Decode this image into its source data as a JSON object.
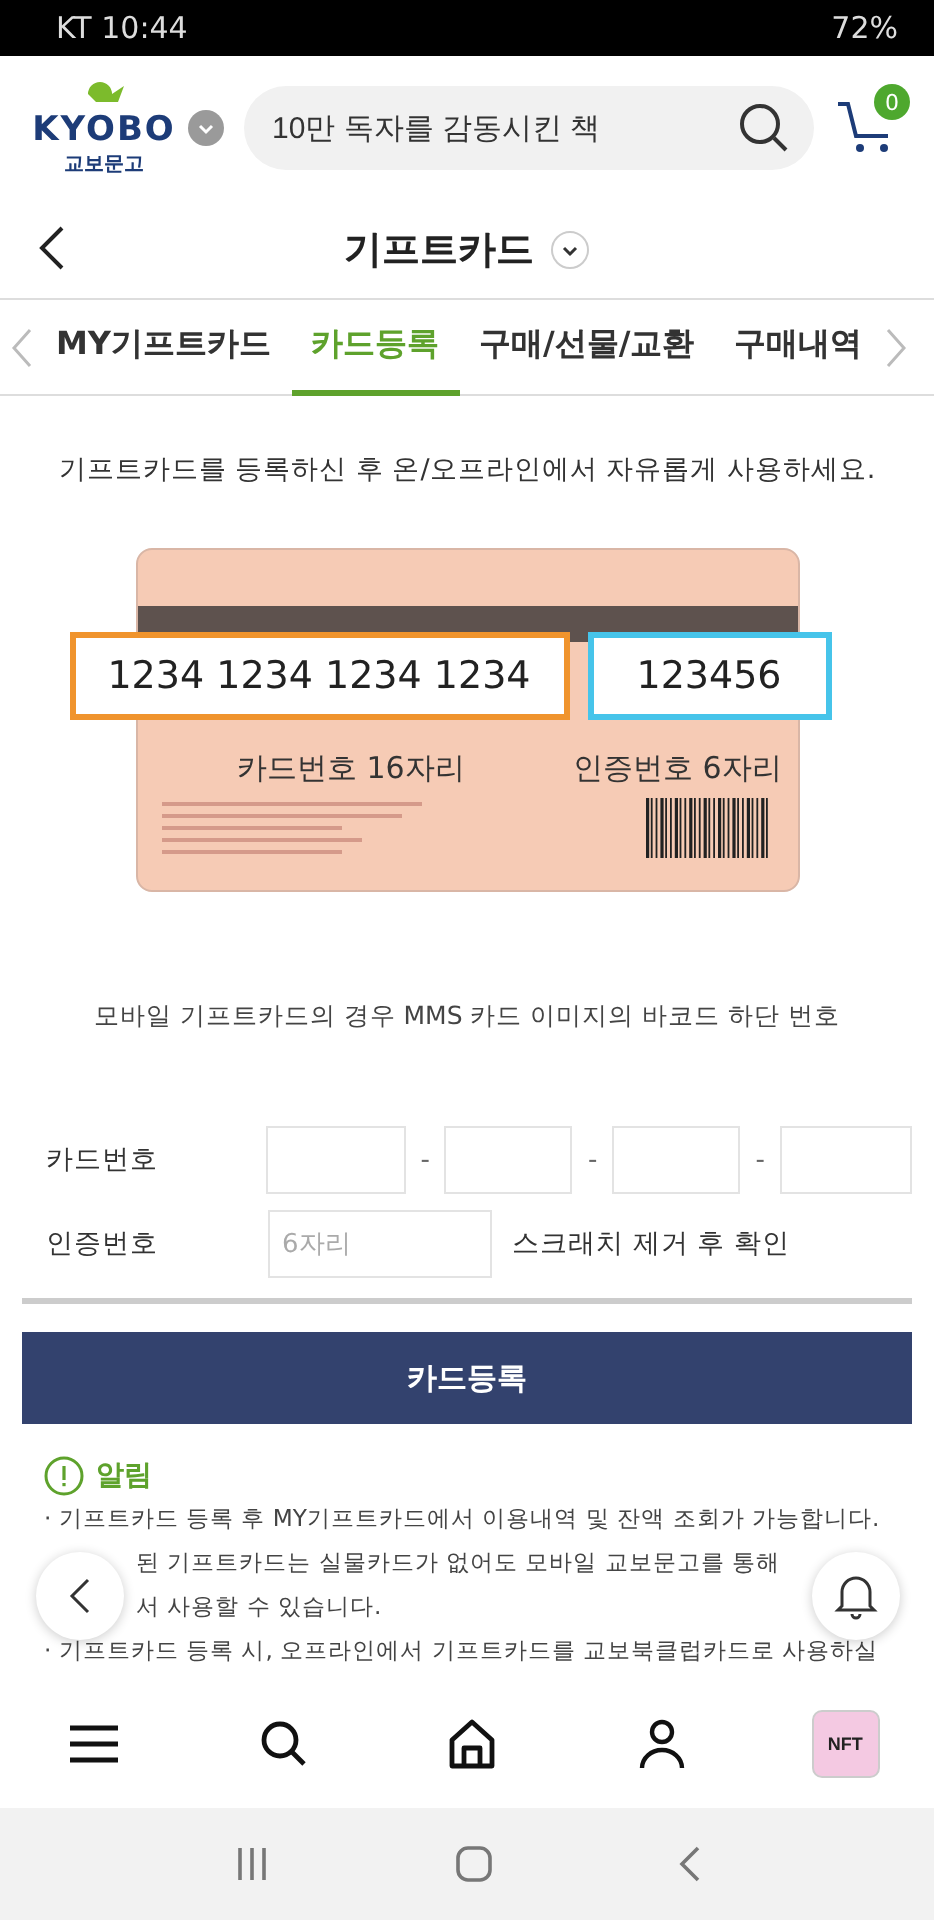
{
  "status_bar": {
    "carrier": "KT",
    "time": "10:44",
    "battery": "72%"
  },
  "header": {
    "logo_text": "KYOBO",
    "logo_sub": "교보문고",
    "search": {
      "placeholder": "10만 독자를 감동시킨 책"
    },
    "cart_count": "0"
  },
  "page_title": "기프트카드",
  "tabs": [
    {
      "label": "MY기프트카드",
      "selected": false
    },
    {
      "label": "카드등록",
      "selected": true
    },
    {
      "label": "구매/선물/교환",
      "selected": false
    },
    {
      "label": "구매내역",
      "selected": false
    }
  ],
  "intro": "기프트카드를 등록하신 후 온/오프라인에서 자유롭게 사용하세요.",
  "card_image": {
    "number": "1234 1234 1234 1234",
    "code": "123456",
    "number_label": "카드번호 16자리",
    "code_label": "인증번호 6자리"
  },
  "card_caption": "모바일 기프트카드의 경우 MMS 카드 이미지의 바코드 하단 번호",
  "form": {
    "card_number_label": "카드번호",
    "separators": [
      "-",
      "-",
      "-"
    ],
    "pin_label": "인증번호",
    "pin": {
      "placeholder": "6자리"
    },
    "pin_hint": "스크래치 제거 후 확인"
  },
  "submit_button": "카드등록",
  "notice": {
    "title": "알림",
    "lines": [
      "· 기프트카드 등록 후 MY기프트카드에서 이용내역 및 잔액 조회가 가능합니다.",
      "된 기프트카드는 실물카드가 없어도 모바일 교보문고를 통해",
      "서 사용할 수 있습니다.",
      "· 기프트카드 등록 시, 오프라인에서 기프트카드를 교보북클럽카드로 사용하실"
    ]
  },
  "nft_badge": "NFT"
}
